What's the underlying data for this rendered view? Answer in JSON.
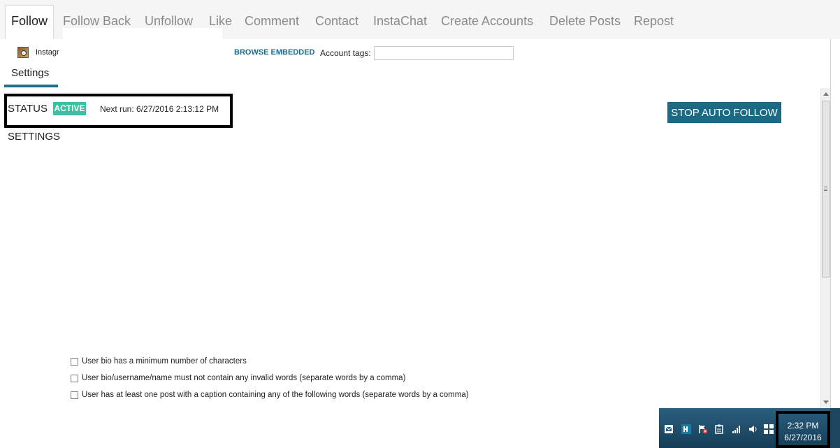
{
  "tabs": [
    {
      "label": "Follow",
      "active": true
    },
    {
      "label": "Follow Back",
      "active": false
    },
    {
      "label": "Unfollow",
      "active": false
    },
    {
      "label": "Like",
      "active": false
    },
    {
      "label": "Comment",
      "active": false
    },
    {
      "label": "Contact",
      "active": false
    },
    {
      "label": "InstaChat",
      "active": false
    },
    {
      "label": "Create Accounts",
      "active": false
    },
    {
      "label": "Delete Posts",
      "active": false
    },
    {
      "label": "Repost",
      "active": false
    }
  ],
  "account": {
    "icon": "instagram-app-icon",
    "label": "Instagr"
  },
  "toolbar": {
    "browse_label": "BROWSE EMBEDDED",
    "tags_label": "Account tags:",
    "tags_value": ""
  },
  "subtab": {
    "label": "Settings"
  },
  "status": {
    "label": "STATUS",
    "badge": "ACTIVE",
    "next_run": "Next run: 6/27/2016 2:13:12 PM"
  },
  "settings_heading": "SETTINGS",
  "actions": {
    "stop_label": "STOP AUTO FOLLOW"
  },
  "filters": [
    {
      "label": "User bio has a minimum number of characters",
      "checked": false
    },
    {
      "label": "User bio/username/name must not contain any invalid words (separate words by a comma)",
      "checked": false
    },
    {
      "label": "User has at least one post with a caption containing any of the following words (separate words by a comma)",
      "checked": false
    }
  ],
  "taskbar": {
    "time": "2:32 PM",
    "date": "6/27/2016",
    "tray_icons": [
      "mail-tray-icon",
      "app-tray-icon",
      "flag-error-icon",
      "clipboard-icon",
      "network-signal-icon",
      "volume-icon",
      "windows-flag-icon"
    ]
  },
  "colors": {
    "accent": "#1a6a85",
    "badge": "#3fbf9f",
    "link": "#1a6b8f",
    "taskbar": "#1f4e6b"
  }
}
